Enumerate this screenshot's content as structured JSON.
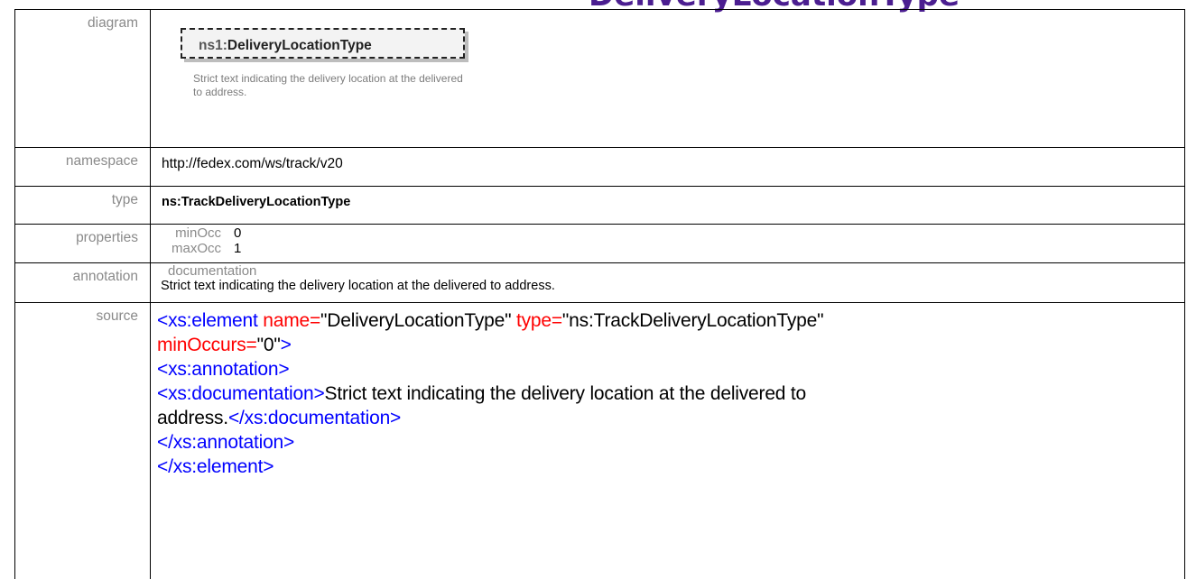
{
  "heading": "DeliveryLocationType",
  "rows": {
    "diagram": {
      "label": "diagram",
      "element_prefix": "ns1:",
      "element_name": "DeliveryLocationType",
      "element_doc": "Strict text indicating the delivery location at the delivered to address."
    },
    "namespace": {
      "label": "namespace",
      "value": "http://fedex.com/ws/track/v20"
    },
    "type": {
      "label": "type",
      "value": "ns:TrackDeliveryLocationType"
    },
    "properties": {
      "label": "properties",
      "items": [
        {
          "key": "minOcc",
          "value": "0"
        },
        {
          "key": "maxOcc",
          "value": "1"
        }
      ]
    },
    "annotation": {
      "label": "annotation",
      "key": "documentation",
      "value": "Strict text indicating  the delivery location at the delivered to address."
    },
    "source": {
      "label": "source",
      "line1": {
        "open": "<xs:element",
        "attr1_name": " name=",
        "attr1_value": "\"DeliveryLocationType\"",
        "attr2_name": " type=",
        "attr2_value": "\"ns:TrackDeliveryLocationType\""
      },
      "line2": {
        "attr3_name": "minOccurs=",
        "attr3_value": "\"0\"",
        "close": ">"
      },
      "line3": " <xs:annotation>",
      "line4": {
        "open": "  <xs:documentation>",
        "text": "Strict text indicating the delivery location at the delivered to"
      },
      "line5": {
        "text": "address.",
        "close": "</xs:documentation>"
      },
      "line6": " </xs:annotation>",
      "line7": "</xs:element>"
    }
  }
}
